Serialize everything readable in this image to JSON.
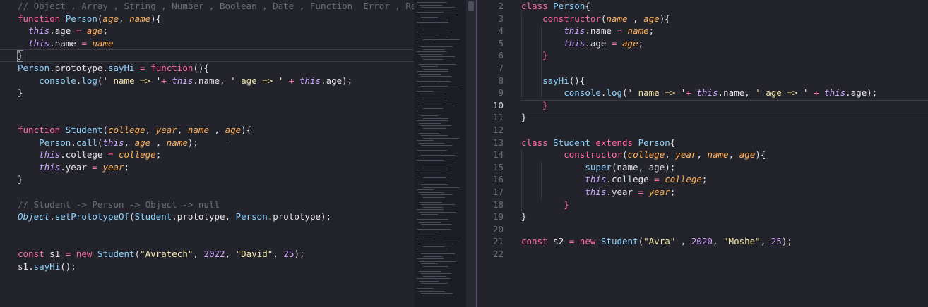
{
  "left_editor": {
    "lines": [
      [
        {
          "t": "// Object , Array , String , Number , Boolean , Date , Function  Error , RegExp",
          "c": "cm"
        }
      ],
      [
        {
          "t": "function ",
          "c": "kw"
        },
        {
          "t": "Person",
          "c": "fn"
        },
        {
          "t": "("
        },
        {
          "t": "age",
          "c": "par"
        },
        {
          "t": ", "
        },
        {
          "t": "name",
          "c": "par"
        },
        {
          "t": "){"
        }
      ],
      [
        {
          "t": "  "
        },
        {
          "t": "this",
          "c": "thiskw"
        },
        {
          "t": ".age "
        },
        {
          "t": "=",
          "c": "pink"
        },
        {
          "t": " "
        },
        {
          "t": "age",
          "c": "par"
        },
        {
          "t": ";"
        }
      ],
      [
        {
          "t": "  "
        },
        {
          "t": "this",
          "c": "thiskw"
        },
        {
          "t": ".name "
        },
        {
          "t": "=",
          "c": "pink"
        },
        {
          "t": " "
        },
        {
          "t": "name",
          "c": "par"
        }
      ],
      [
        {
          "t": "}"
        }
      ],
      [
        {
          "t": "Person",
          "c": "cls"
        },
        {
          "t": "."
        },
        {
          "t": "prototype",
          "c": "prop"
        },
        {
          "t": "."
        },
        {
          "t": "sayHi",
          "c": "fn"
        },
        {
          "t": " = ",
          "c": "pink"
        },
        {
          "t": "function",
          "c": "kw"
        },
        {
          "t": "(){"
        }
      ],
      [
        {
          "t": "    "
        },
        {
          "t": "console",
          "c": "fn"
        },
        {
          "t": "."
        },
        {
          "t": "log",
          "c": "fn"
        },
        {
          "t": "("
        },
        {
          "t": "' name => '",
          "c": "str"
        },
        {
          "t": "+ ",
          "c": "pink"
        },
        {
          "t": "this",
          "c": "thiskw"
        },
        {
          "t": ".name, "
        },
        {
          "t": "' age => '",
          "c": "str"
        },
        {
          "t": " + ",
          "c": "pink"
        },
        {
          "t": "this",
          "c": "thiskw"
        },
        {
          "t": ".age);"
        }
      ],
      [
        {
          "t": "}"
        }
      ],
      [],
      [],
      [
        {
          "t": "function ",
          "c": "kw"
        },
        {
          "t": "Student",
          "c": "fn"
        },
        {
          "t": "("
        },
        {
          "t": "college",
          "c": "par"
        },
        {
          "t": ", "
        },
        {
          "t": "year",
          "c": "par"
        },
        {
          "t": ", "
        },
        {
          "t": "name",
          "c": "par"
        },
        {
          "t": " , "
        },
        {
          "t": "age",
          "c": "par"
        },
        {
          "t": "){"
        }
      ],
      [
        {
          "t": "    "
        },
        {
          "t": "Person",
          "c": "fn"
        },
        {
          "t": "."
        },
        {
          "t": "call",
          "c": "fn"
        },
        {
          "t": "("
        },
        {
          "t": "this",
          "c": "thiskw"
        },
        {
          "t": ", "
        },
        {
          "t": "age",
          "c": "par"
        },
        {
          "t": " , "
        },
        {
          "t": "name",
          "c": "par"
        },
        {
          "t": ");"
        }
      ],
      [
        {
          "t": "    "
        },
        {
          "t": "this",
          "c": "thiskw"
        },
        {
          "t": ".college "
        },
        {
          "t": "=",
          "c": "pink"
        },
        {
          "t": " "
        },
        {
          "t": "college",
          "c": "par"
        },
        {
          "t": ";"
        }
      ],
      [
        {
          "t": "    "
        },
        {
          "t": "this",
          "c": "thiskw"
        },
        {
          "t": ".year "
        },
        {
          "t": "=",
          "c": "pink"
        },
        {
          "t": " "
        },
        {
          "t": "year",
          "c": "par"
        },
        {
          "t": ";"
        }
      ],
      [
        {
          "t": "}"
        }
      ],
      [],
      [
        {
          "t": "// Student -> Person -> Object -> null",
          "c": "cm"
        }
      ],
      [
        {
          "t": "Object",
          "c": "obj"
        },
        {
          "t": "."
        },
        {
          "t": "setPrototypeOf",
          "c": "fn"
        },
        {
          "t": "("
        },
        {
          "t": "Student",
          "c": "cls"
        },
        {
          "t": ".prototype, "
        },
        {
          "t": "Person",
          "c": "cls"
        },
        {
          "t": ".prototype);"
        }
      ],
      [],
      [],
      [
        {
          "t": "const ",
          "c": "kw"
        },
        {
          "t": "s1 "
        },
        {
          "t": "=",
          "c": "pink"
        },
        {
          "t": " "
        },
        {
          "t": "new ",
          "c": "kw"
        },
        {
          "t": "Student",
          "c": "fn"
        },
        {
          "t": "("
        },
        {
          "t": "\"Avratech\"",
          "c": "str"
        },
        {
          "t": ", "
        },
        {
          "t": "2022",
          "c": "num"
        },
        {
          "t": ", "
        },
        {
          "t": "\"David\"",
          "c": "str"
        },
        {
          "t": ", "
        },
        {
          "t": "25",
          "c": "num"
        },
        {
          "t": ");"
        }
      ],
      [
        {
          "t": "s1",
          "c": "prop"
        },
        {
          "t": "."
        },
        {
          "t": "sayHi",
          "c": "fn"
        },
        {
          "t": "();"
        }
      ]
    ]
  },
  "right_editor": {
    "line_numbers": [
      "2",
      "3",
      "4",
      "5",
      "6",
      "7",
      "8",
      "9",
      "10",
      "11",
      "12",
      "13",
      "14",
      "15",
      "16",
      "17",
      "18",
      "19",
      "20",
      "21",
      "22"
    ],
    "active_line": "10",
    "lines": [
      [
        {
          "t": "class ",
          "c": "kw"
        },
        {
          "t": "Person",
          "c": "cls"
        },
        {
          "t": "{"
        }
      ],
      [
        {
          "t": "    "
        },
        {
          "t": "constructor",
          "c": "kw"
        },
        {
          "t": "("
        },
        {
          "t": "name",
          "c": "par"
        },
        {
          "t": " , "
        },
        {
          "t": "age",
          "c": "par"
        },
        {
          "t": "){"
        }
      ],
      [
        {
          "t": "        "
        },
        {
          "t": "this",
          "c": "thiskw"
        },
        {
          "t": ".name "
        },
        {
          "t": "=",
          "c": "pink"
        },
        {
          "t": " "
        },
        {
          "t": "name",
          "c": "par"
        },
        {
          "t": ";"
        }
      ],
      [
        {
          "t": "        "
        },
        {
          "t": "this",
          "c": "thiskw"
        },
        {
          "t": ".age "
        },
        {
          "t": "=",
          "c": "pink"
        },
        {
          "t": " "
        },
        {
          "t": "age",
          "c": "par"
        },
        {
          "t": ";"
        }
      ],
      [
        {
          "t": "    "
        },
        {
          "t": "}",
          "c": "pink"
        }
      ],
      [],
      [
        {
          "t": "    "
        },
        {
          "t": "sayHi",
          "c": "fn"
        },
        {
          "t": "(){"
        }
      ],
      [
        {
          "t": "        "
        },
        {
          "t": "console",
          "c": "fn"
        },
        {
          "t": "."
        },
        {
          "t": "log",
          "c": "fn"
        },
        {
          "t": "("
        },
        {
          "t": "' name => '",
          "c": "str"
        },
        {
          "t": "+ ",
          "c": "pink"
        },
        {
          "t": "this",
          "c": "thiskw"
        },
        {
          "t": ".name, "
        },
        {
          "t": "' age => '",
          "c": "str"
        },
        {
          "t": " + ",
          "c": "pink"
        },
        {
          "t": "this",
          "c": "thiskw"
        },
        {
          "t": ".age);"
        }
      ],
      [
        {
          "t": "    "
        },
        {
          "t": "}",
          "c": "pink"
        }
      ],
      [
        {
          "t": "}"
        }
      ],
      [],
      [
        {
          "t": "class ",
          "c": "kw"
        },
        {
          "t": "Student ",
          "c": "cls"
        },
        {
          "t": "extends ",
          "c": "kw"
        },
        {
          "t": "Person",
          "c": "cls"
        },
        {
          "t": "{"
        }
      ],
      [
        {
          "t": "        "
        },
        {
          "t": "constructor",
          "c": "kw"
        },
        {
          "t": "("
        },
        {
          "t": "college",
          "c": "par"
        },
        {
          "t": ", "
        },
        {
          "t": "year",
          "c": "par"
        },
        {
          "t": ", "
        },
        {
          "t": "name",
          "c": "par"
        },
        {
          "t": ", "
        },
        {
          "t": "age",
          "c": "par"
        },
        {
          "t": "){"
        }
      ],
      [
        {
          "t": "            "
        },
        {
          "t": "super",
          "c": "fn"
        },
        {
          "t": "("
        },
        {
          "t": "name",
          "c": "prop"
        },
        {
          "t": ", "
        },
        {
          "t": "age",
          "c": "prop"
        },
        {
          "t": ");"
        }
      ],
      [
        {
          "t": "            "
        },
        {
          "t": "this",
          "c": "thiskw"
        },
        {
          "t": ".college "
        },
        {
          "t": "=",
          "c": "pink"
        },
        {
          "t": " "
        },
        {
          "t": "college",
          "c": "par"
        },
        {
          "t": ";"
        }
      ],
      [
        {
          "t": "            "
        },
        {
          "t": "this",
          "c": "thiskw"
        },
        {
          "t": ".year "
        },
        {
          "t": "=",
          "c": "pink"
        },
        {
          "t": " "
        },
        {
          "t": "year",
          "c": "par"
        },
        {
          "t": ";"
        }
      ],
      [
        {
          "t": "        "
        },
        {
          "t": "}",
          "c": "pink"
        }
      ],
      [
        {
          "t": "}"
        }
      ],
      [],
      [
        {
          "t": "const ",
          "c": "kw"
        },
        {
          "t": "s2 "
        },
        {
          "t": "=",
          "c": "pink"
        },
        {
          "t": " "
        },
        {
          "t": "new ",
          "c": "kw"
        },
        {
          "t": "Student",
          "c": "fn"
        },
        {
          "t": "("
        },
        {
          "t": "\"Avra\"",
          "c": "str"
        },
        {
          "t": " , "
        },
        {
          "t": "2020",
          "c": "num"
        },
        {
          "t": ", "
        },
        {
          "t": "\"Moshe\"",
          "c": "str"
        },
        {
          "t": ", "
        },
        {
          "t": "25",
          "c": "num"
        },
        {
          "t": ");"
        }
      ],
      []
    ]
  },
  "colors": {
    "background": "#22232b",
    "keyword": "#ff6da0",
    "function": "#8fd4ff",
    "parameter": "#ffb15a",
    "this": "#cda8ff",
    "string": "#f4e7a8",
    "number": "#d8a8ff",
    "comment": "#6c6d78"
  }
}
